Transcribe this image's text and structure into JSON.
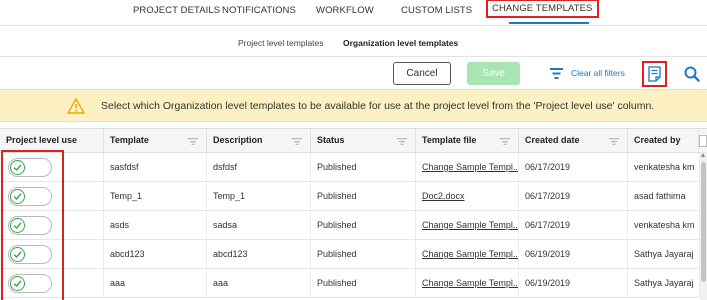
{
  "topnav": {
    "tabs": [
      {
        "label": "PROJECT DETAILS",
        "active": false
      },
      {
        "label": "NOTIFICATIONS",
        "active": false
      },
      {
        "label": "WORKFLOW",
        "active": false
      },
      {
        "label": "CUSTOM LISTS",
        "active": false
      },
      {
        "label": "CHANGE TEMPLATES",
        "active": true
      }
    ]
  },
  "subtabs": [
    {
      "label": "Project level templates",
      "active": false
    },
    {
      "label": "Organization level templates",
      "active": true
    }
  ],
  "toolbar": {
    "cancel_label": "Cancel",
    "save_label": "Save",
    "clear_filters_label": "Clear all filters"
  },
  "banner": {
    "message": "Select which Organization level templates to be available for use at the project level from the 'Project level use' column."
  },
  "table": {
    "columns": [
      {
        "label": "Project level use",
        "filter": false
      },
      {
        "label": "Template",
        "filter": true
      },
      {
        "label": "Description",
        "filter": true
      },
      {
        "label": "Status",
        "filter": true
      },
      {
        "label": "Template file",
        "filter": true
      },
      {
        "label": "Created date",
        "filter": true
      },
      {
        "label": "Created by",
        "filter": false
      }
    ],
    "rows": [
      {
        "enabled": true,
        "template": "sasfdsf",
        "description": "dsfdsf",
        "status": "Published",
        "file": "Change Sample Templ...",
        "created_date": "06/17/2019",
        "created_by": "venkatesha km"
      },
      {
        "enabled": true,
        "template": "Temp_1",
        "description": "Temp_1",
        "status": "Published",
        "file": "Doc2.docx",
        "created_date": "06/17/2019",
        "created_by": "asad fathima"
      },
      {
        "enabled": true,
        "template": "asds",
        "description": "sadsa",
        "status": "Published",
        "file": "Change Sample Templ...",
        "created_date": "06/17/2019",
        "created_by": "venkatesha km"
      },
      {
        "enabled": true,
        "template": "abcd123",
        "description": "abcd123",
        "status": "Published",
        "file": "Change Sample Templ...",
        "created_date": "06/19/2019",
        "created_by": "Sathya Jayaraj"
      },
      {
        "enabled": true,
        "template": "aaa",
        "description": "aaa",
        "status": "Published",
        "file": "Change Sample Templ...",
        "created_date": "06/19/2019",
        "created_by": "Sathya Jayaraj"
      }
    ]
  },
  "colors": {
    "accent": "#1d78c1",
    "highlight": "#e0201f",
    "save_disabled": "#a7e5b5",
    "banner_bg": "#fdf1c3",
    "toggle_on": "#3aa14d"
  },
  "icons": {
    "filter": "filter-icon",
    "document": "document-icon",
    "search": "search-icon",
    "warning": "warning-icon",
    "check": "check-icon"
  }
}
